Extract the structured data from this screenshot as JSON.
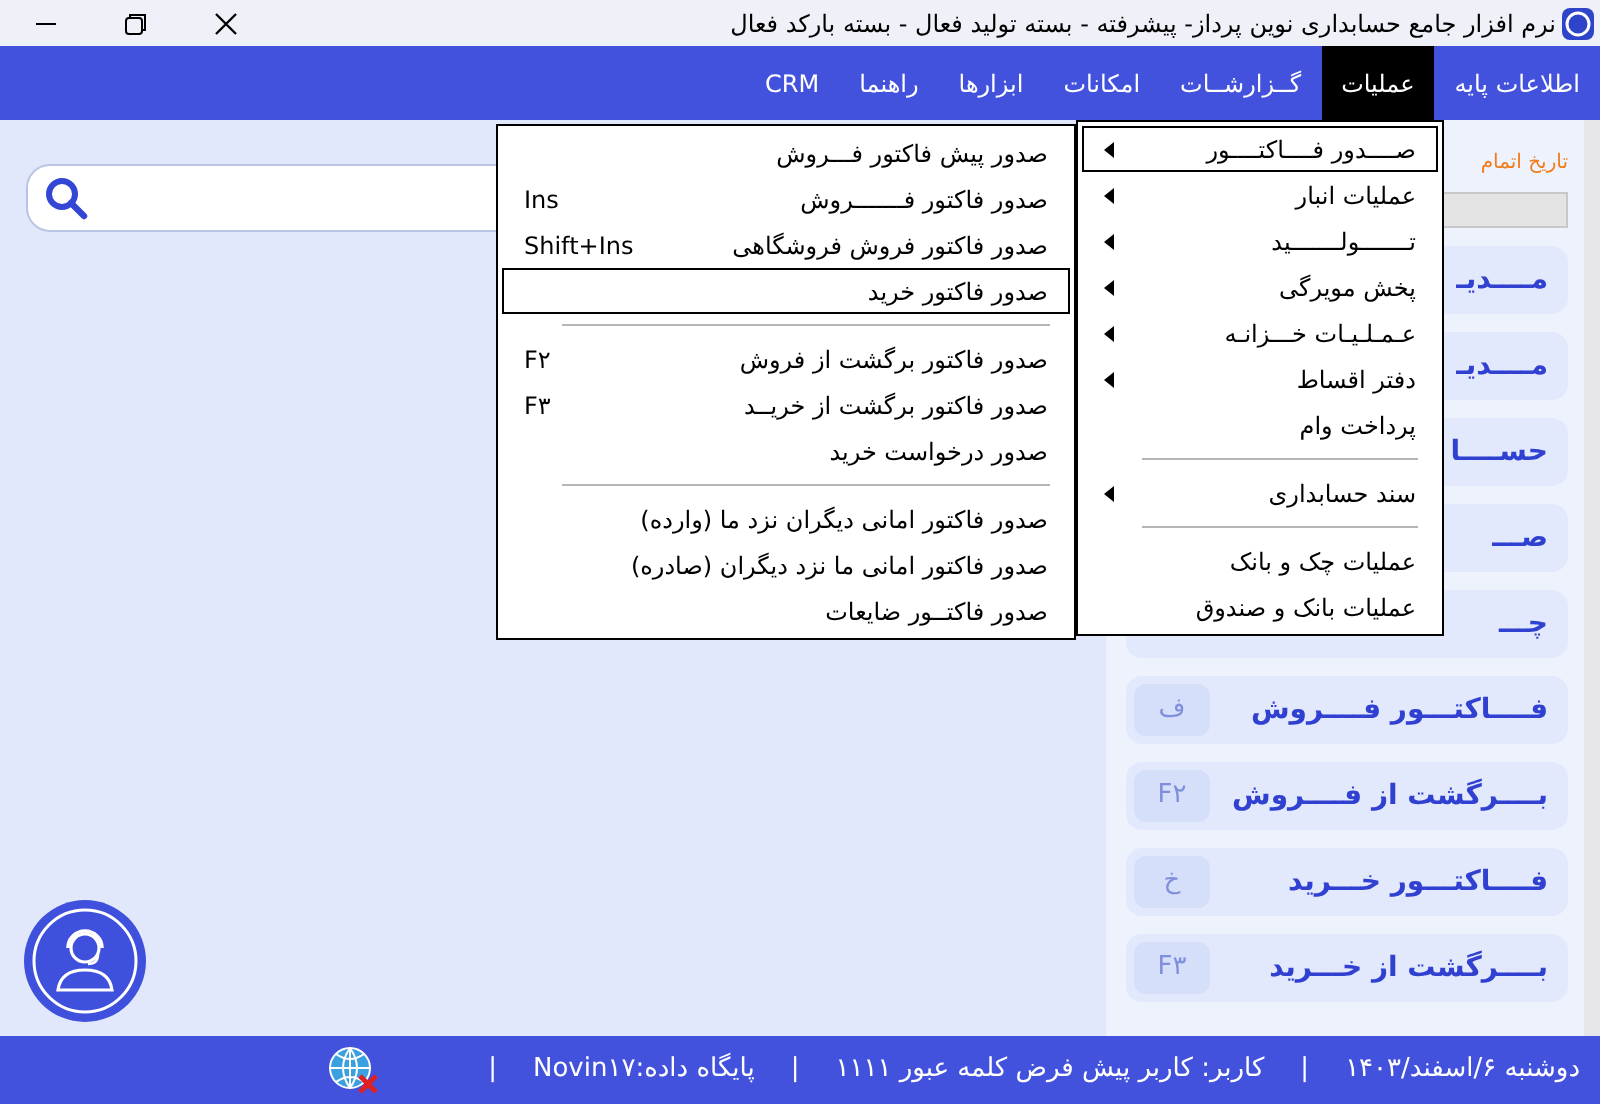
{
  "window": {
    "title": "نرم افزار جامع حسابداری نوین پرداز- پیشرفته - بسته تولید فعال - بسته بارکد فعال"
  },
  "menubar": [
    {
      "label": "اطلاعات پایه",
      "selected": false
    },
    {
      "label": "عملیات",
      "selected": true
    },
    {
      "label": "گــزارشــات",
      "selected": false
    },
    {
      "label": "امکانات",
      "selected": false
    },
    {
      "label": "ابزارها",
      "selected": false
    },
    {
      "label": "راهنما",
      "selected": false
    },
    {
      "label": "CRM",
      "selected": false
    }
  ],
  "dropdown": [
    {
      "kind": "item",
      "label": "صــــدور فــــاکتــــور",
      "submenu": true,
      "selected": true
    },
    {
      "kind": "item",
      "label": "عملیات انبار",
      "submenu": true,
      "selected": false
    },
    {
      "kind": "item",
      "label": "تـــــــولـــــــید",
      "submenu": true,
      "selected": false
    },
    {
      "kind": "item",
      "label": "پخش مویرگی",
      "submenu": true,
      "selected": false
    },
    {
      "kind": "item",
      "label": "عـمـلـیـات خـــزانـه",
      "submenu": true,
      "selected": false
    },
    {
      "kind": "item",
      "label": "دفتر اقساط",
      "submenu": true,
      "selected": false
    },
    {
      "kind": "item",
      "label": "پرداخت وام",
      "submenu": false,
      "selected": false
    },
    {
      "kind": "separator"
    },
    {
      "kind": "item",
      "label": "سند حسابداری",
      "submenu": true,
      "selected": false
    },
    {
      "kind": "separator"
    },
    {
      "kind": "item",
      "label": "عملیات چک و بانک",
      "submenu": false,
      "selected": false
    },
    {
      "kind": "item",
      "label": "عملیات بانک و صندوق",
      "submenu": false,
      "selected": false
    }
  ],
  "submenu": [
    {
      "kind": "item",
      "label": "صدور پیش فاکتور فـــروش",
      "selected": false
    },
    {
      "kind": "item",
      "label": "صدور فاکتور فـــــــروش",
      "shortcut": "Ins",
      "selected": false
    },
    {
      "kind": "item",
      "label": "صدور فاکتور فروش فروشگاهی",
      "shortcut": "Shift+Ins",
      "selected": false
    },
    {
      "kind": "item",
      "label": "صدور فاکتور خرید",
      "selected": true
    },
    {
      "kind": "separator"
    },
    {
      "kind": "item",
      "label": "صدور فاکتور برگشت از فروش",
      "shortcut": "F۲",
      "selected": false
    },
    {
      "kind": "item",
      "label": "صدور فاکتور برگشت از خریــد",
      "shortcut": "F۳",
      "selected": false
    },
    {
      "kind": "item",
      "label": "صدور درخواست خرید",
      "selected": false
    },
    {
      "kind": "separator"
    },
    {
      "kind": "item",
      "label": "صدور فاکتور امانی دیگران نزد ما (وارده)",
      "selected": false
    },
    {
      "kind": "item",
      "label": "صدور فاکتور امانی ما نزد دیگران (صادره)",
      "selected": false
    },
    {
      "kind": "item",
      "label": "صدور فاکتــور ضایعات",
      "selected": false
    }
  ],
  "panel": {
    "notice": "تاریخ اتمام",
    "shortcuts": [
      {
        "label": "مــــدیـ"
      },
      {
        "label": "مــــدیـ"
      },
      {
        "label": "حســــا"
      },
      {
        "label": "صـــ"
      },
      {
        "label": "چـــ"
      },
      {
        "label": "فــــاکتـــور فــــروش",
        "key": "ف"
      },
      {
        "label": "بــــرگشت از فــــروش",
        "key": "F۲"
      },
      {
        "label": "فــــاکتـــور خـــرید",
        "key": "خ"
      },
      {
        "label": "بــــرگشت از خـــرید",
        "key": "F۳"
      }
    ]
  },
  "status_bar": {
    "date": "دوشنبه ۶/اسفند/۱۴۰۳",
    "user": "کاربر: کاربر پیش فرض کلمه عبور ۱۱۱۱",
    "database": "پایگاه داده:Novin۱۷",
    "separators": [
      "|",
      "|",
      "|"
    ]
  }
}
